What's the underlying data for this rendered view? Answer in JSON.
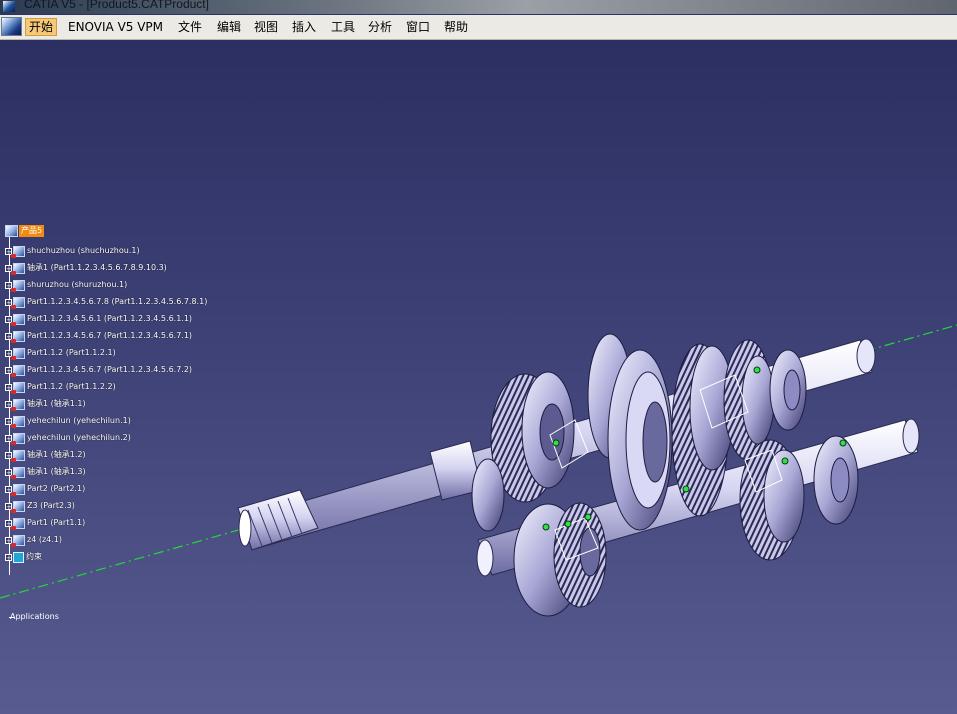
{
  "window": {
    "title": "CATIA V5 - [Product5.CATProduct]"
  },
  "menubar": {
    "items": [
      {
        "label": "开始",
        "active": true
      },
      {
        "label": "ENOVIA V5 VPM",
        "active": false
      },
      {
        "label": "文件",
        "active": false
      },
      {
        "label": "编辑",
        "active": false
      },
      {
        "label": "视图",
        "active": false
      },
      {
        "label": "插入",
        "active": false
      },
      {
        "label": "工具",
        "active": false
      },
      {
        "label": "分析",
        "active": false
      },
      {
        "label": "窗口",
        "active": false
      },
      {
        "label": "帮助",
        "active": false
      }
    ]
  },
  "tree": {
    "root": "产品5",
    "items": [
      {
        "label": "shuchuzhou (shuchuzhou.1)"
      },
      {
        "label": "轴承1 (Part1.1.2.3.4.5.6.7.8.9.10.3)"
      },
      {
        "label": "shuruzhou (shuruzhou.1)"
      },
      {
        "label": "Part1.1.2.3.4.5.6.7.8 (Part1.1.2.3.4.5.6.7.8.1)"
      },
      {
        "label": "Part1.1.2.3.4.5.6.1 (Part1.1.2.3.4.5.6.1.1)"
      },
      {
        "label": "Part1.1.2.3.4.5.6.7 (Part1.1.2.3.4.5.6.7.1)"
      },
      {
        "label": "Part1.1.2 (Part1.1.2.1)"
      },
      {
        "label": "Part1.1.2.3.4.5.6.7 (Part1.1.2.3.4.5.6.7.2)"
      },
      {
        "label": "Part1.1.2 (Part1.1.2.2)"
      },
      {
        "label": "轴承1 (轴承1.1)"
      },
      {
        "label": "yehechilun (yehechilun.1)"
      },
      {
        "label": "yehechilun (yehechilun.2)"
      },
      {
        "label": "轴承1 (轴承1.2)"
      },
      {
        "label": "轴承1 (轴承1.3)"
      },
      {
        "label": "Part2 (Part2.1)"
      },
      {
        "label": "Z3 (Part2.3)"
      },
      {
        "label": "Part1 (Part1.1)"
      },
      {
        "label": "z4 (z4.1)"
      }
    ],
    "constraints_label": "约束",
    "applications_label": "Applications"
  },
  "colors": {
    "background_top": "#2c2f61",
    "background_bottom": "#575b8f",
    "axis_line": "#22d83a",
    "root_highlight": "#f28a14"
  }
}
